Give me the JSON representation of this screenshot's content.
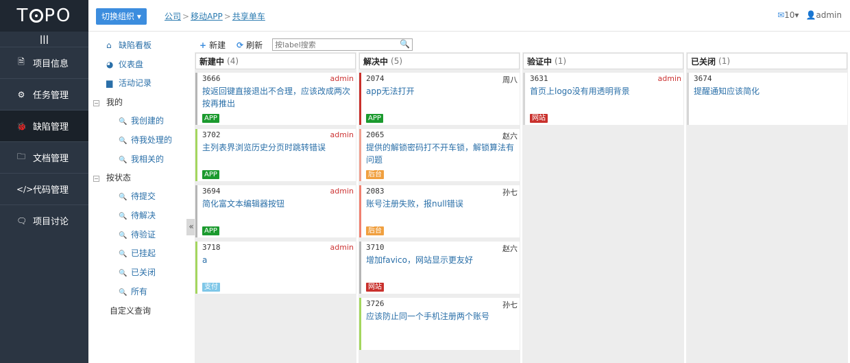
{
  "app": {
    "logo": "TOPO"
  },
  "sidebar": {
    "items": [
      {
        "icon": "document-icon",
        "glyph": "🗎",
        "label": "项目信息",
        "active": false
      },
      {
        "icon": "tasks-icon",
        "glyph": "⚙",
        "label": "任务管理",
        "active": false
      },
      {
        "icon": "bug-icon",
        "glyph": "🐞",
        "label": "缺陷管理",
        "active": true
      },
      {
        "icon": "folder-icon",
        "glyph": "🗀",
        "label": "文档管理",
        "active": false
      },
      {
        "icon": "code-icon",
        "glyph": "</>",
        "label": "代码管理",
        "active": false
      },
      {
        "icon": "comments-icon",
        "glyph": "🗨",
        "label": "项目讨论",
        "active": false
      }
    ]
  },
  "header": {
    "org_button": "切换组织",
    "breadcrumb": [
      "公司",
      "移动APP",
      "共享单车"
    ],
    "mail_count": "10",
    "user": "admin"
  },
  "subnav": {
    "board": "缺陷看板",
    "dashboard": "仪表盘",
    "activity": "活动记录",
    "mine": "我的",
    "mine_items": [
      "我创建的",
      "待我处理的",
      "我相关的"
    ],
    "by_status": "按状态",
    "status_items": [
      "待提交",
      "待解决",
      "待验证",
      "已挂起",
      "已关闭",
      "所有"
    ],
    "custom_query": "自定义查询"
  },
  "toolbar": {
    "new_label": "新建",
    "refresh_label": "刷新",
    "search_placeholder": "按label搜索"
  },
  "colors": {
    "green": "#1b9a2e",
    "orange": "#f0a040",
    "red": "#c9302c",
    "light_blue": "#7fc7e8"
  },
  "columns": [
    {
      "title": "新建中",
      "count": "(4)",
      "cards": [
        {
          "id": "3666",
          "owner": "admin",
          "title": "按返回键直接退出不合理，应该改成两次按再推出",
          "tag": "APP",
          "tag_color": "#1b9a2e",
          "border": "#b5b5b5"
        },
        {
          "id": "3702",
          "owner": "admin",
          "title": "主列表界浏览历史分页时跳转错误",
          "tag": "APP",
          "tag_color": "#1b9a2e",
          "border": "#a4d65e"
        },
        {
          "id": "3694",
          "owner": "admin",
          "title": "简化富文本编辑器按钮",
          "tag": "APP",
          "tag_color": "#1b9a2e",
          "border": "#b5b5b5"
        },
        {
          "id": "3718",
          "owner": "admin",
          "title": "a",
          "tag": "支付",
          "tag_color": "#7fc7e8",
          "border": "#a4d65e"
        }
      ]
    },
    {
      "title": "解决中",
      "count": "(5)",
      "cards": [
        {
          "id": "2074",
          "owner": "周八",
          "title": "app无法打开",
          "tag": "APP",
          "tag_color": "#1b9a2e",
          "border": "#c9302c"
        },
        {
          "id": "2065",
          "owner": "赵六",
          "title": "提供的解锁密码打不开车锁，解锁算法有问题",
          "tag": "后台",
          "tag_color": "#f0a040",
          "border": "#f0a090"
        },
        {
          "id": "2083",
          "owner": "孙七",
          "title": "账号注册失败，报null错误",
          "tag": "后台",
          "tag_color": "#f0a040",
          "border": "#f08070"
        },
        {
          "id": "3710",
          "owner": "赵六",
          "title": "增加favico，网站显示更友好",
          "tag": "网站",
          "tag_color": "#c9302c",
          "border": "#b5b5b5"
        },
        {
          "id": "3726",
          "owner": "孙七",
          "title": "应该防止同一个手机注册两个账号",
          "tag": "",
          "tag_color": "",
          "border": "#a4d65e"
        }
      ]
    },
    {
      "title": "验证中",
      "count": "(1)",
      "cards": [
        {
          "id": "3631",
          "owner": "admin",
          "title": "首页上logo没有用透明背景",
          "tag": "网站",
          "tag_color": "#c9302c",
          "border": "#d6d6d6"
        }
      ]
    },
    {
      "title": "已关闭",
      "count": "(1)",
      "cards": [
        {
          "id": "3674",
          "owner": "",
          "title": "提醒通知应该简化",
          "tag": "",
          "tag_color": "",
          "border": "#d6d6d6"
        }
      ]
    }
  ]
}
